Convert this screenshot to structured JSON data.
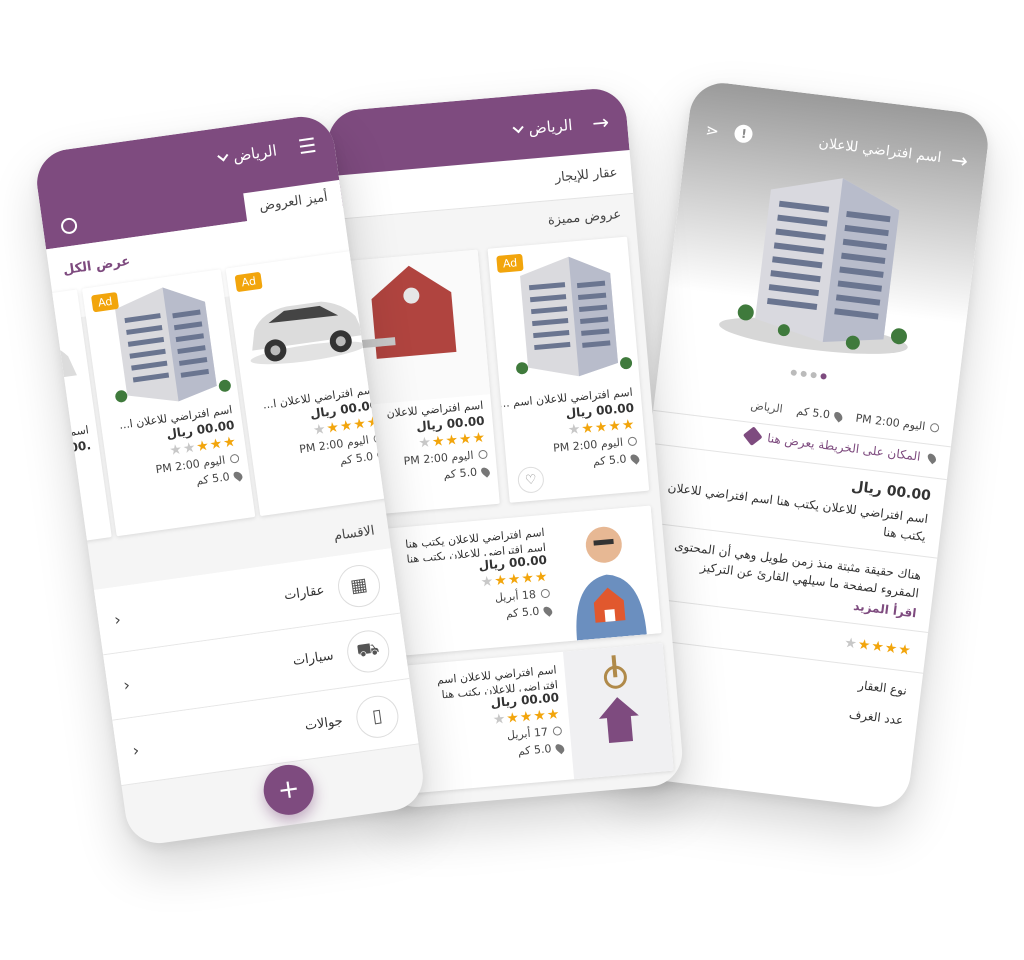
{
  "phone_home": {
    "city": "الرياض",
    "section_title": "أميز العروض",
    "view_all": "عرض الكل",
    "cards": [
      {
        "badge": "Ad",
        "title": "اسم افتراضي للاعلان ا...",
        "price": "00.00 ريال",
        "rating": 3,
        "time": "اليوم 2:00 PM",
        "distance": "5.0 كم"
      },
      {
        "badge": "Ad",
        "title": "اسم افتراضي للاعلان ا...",
        "price": "00.00 ريال",
        "rating": 4,
        "time": "اليوم 2:00 PM",
        "distance": "5.0 كم"
      },
      {
        "title": "اسم",
        "price": ".00"
      }
    ],
    "categories_title": "الاقسام",
    "categories": [
      {
        "label": "عقارات",
        "icon": "building-icon"
      },
      {
        "label": "سيارات",
        "icon": "car-icon"
      },
      {
        "label": "جوالات",
        "icon": "phone-icon"
      }
    ],
    "fab": "+"
  },
  "phone_list": {
    "city": "الرياض",
    "subheader": "عقار للإيجار",
    "section_title": "عروض مميزة",
    "featured": [
      {
        "badge": "Ad",
        "title": "اسم افتراضي للاعلان اسم ...",
        "price": "00.00 ريال",
        "rating": 4,
        "time": "اليوم 2:00 PM",
        "distance": "5.0 كم"
      },
      {
        "title": "اسم افتراضي للاعلان",
        "price": "00.00 ريال",
        "rating": 4,
        "time": "اليوم 2:00 PM",
        "distance": "5.0 كم"
      }
    ],
    "list": [
      {
        "title": "اسم افتراضي للاعلان يكتب هنا اسم افتراضي للاعلان يكتب هنا",
        "price": "00.00 ريال",
        "rating": 4,
        "date": "18 أبريل",
        "distance": "5.0 كم"
      },
      {
        "title": "اسم افتراضي للاعلان اسم افتراضي للاعلان يكتب هنا",
        "price": "00.00 ريال",
        "rating": 4,
        "date": "17 أبريل",
        "distance": "5.0 كم"
      }
    ]
  },
  "phone_detail": {
    "title": "اسم افتراضي للاعلان",
    "time": "اليوم 2:00 PM",
    "distance": "5.0 كم",
    "city": "الرياض",
    "map_text": "المكان على الخريطة يعرض هنا",
    "price": "00.00 ريال",
    "name_text": "اسم افتراضي للاعلان يكتب هنا  اسم افتراضي للاعلان يكتب هنا",
    "description": "هناك حقيقة مثبتة منذ زمن طويل وهي أن المحتوى المقروء لصفحة ما سيلهي القارئ عن التركيز",
    "read_more": "اقرأ المزيد",
    "rating": 4,
    "fields": [
      "نوع العقار",
      "عدد الغرف"
    ]
  },
  "colors": {
    "brand": "#7e4b7f",
    "star": "#f2a50c",
    "badge": "#f2a50c"
  }
}
